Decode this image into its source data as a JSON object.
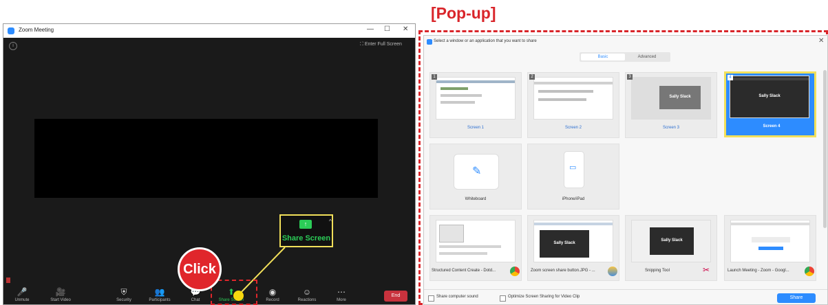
{
  "zoom_window": {
    "title": "Zoom Meeting",
    "controls": {
      "minimize": "—",
      "maximize": "☐",
      "close": "✕"
    },
    "full_screen": "Enter Full Screen",
    "toolbar": [
      {
        "label": "Unmute",
        "icon": "mic-muted-icon",
        "glyph": "🎤"
      },
      {
        "label": "Start Video",
        "icon": "video-off-icon",
        "glyph": "🎥"
      },
      {
        "label": "Security",
        "icon": "shield-icon",
        "glyph": "⛨"
      },
      {
        "label": "Participants",
        "icon": "participants-icon",
        "glyph": "👥"
      },
      {
        "label": "Chat",
        "icon": "chat-icon",
        "glyph": "💬"
      },
      {
        "label": "Share Screen",
        "icon": "share-screen-icon",
        "glyph": "⬆"
      },
      {
        "label": "Record",
        "icon": "record-icon",
        "glyph": "◉"
      },
      {
        "label": "Reactions",
        "icon": "reactions-icon",
        "glyph": "☺"
      },
      {
        "label": "More",
        "icon": "more-icon",
        "glyph": "⋯"
      }
    ],
    "end_label": "End"
  },
  "callout": {
    "label": "Share Screen",
    "click_text": "Click"
  },
  "popup": {
    "header_label": "[Pop-up]",
    "title": "Select a window or an application that you want to share",
    "tabs": [
      "Basic",
      "Advanced"
    ],
    "tiles": [
      {
        "label": "Screen 1",
        "number": "1"
      },
      {
        "label": "Screen 2",
        "number": "2"
      },
      {
        "label": "Screen 3",
        "number": "3",
        "name": "Sally Slack"
      },
      {
        "label": "Screen 4",
        "number": "4",
        "name": "Sally Slack"
      },
      {
        "label": "Whiteboard"
      },
      {
        "label": "iPhone/iPad"
      },
      {
        "label": "Structured Content Create - Dotd..."
      },
      {
        "label": "Zoom screen share button.JPG - ...",
        "name": "Sally Slack"
      },
      {
        "label": "Snipping Tool",
        "name": "Sally Slack"
      },
      {
        "label": "Launch Meeting - Zoom - Googl..."
      }
    ],
    "checkbox_sound": "Share computer sound",
    "checkbox_optimize": "Optimize Screen Sharing for Video Clip",
    "share_label": "Share"
  },
  "colors": {
    "accent": "#2d8cff",
    "highlight": "#f2e05a",
    "annotation_red": "#d9252a",
    "share_green": "#2bcc57"
  }
}
